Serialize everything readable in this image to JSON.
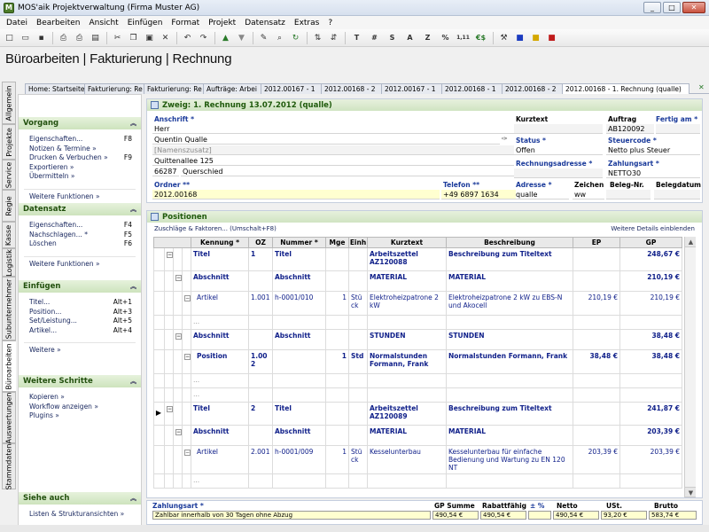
{
  "window": {
    "title": "MOS'aik Projektverwaltung (Firma Muster AG)",
    "min": "_",
    "max": "□",
    "close": "✕"
  },
  "menu": [
    "Datei",
    "Bearbeiten",
    "Ansicht",
    "Einfügen",
    "Format",
    "Projekt",
    "Datensatz",
    "Extras",
    "?"
  ],
  "toolbar": {
    "text_buttons": [
      "T",
      "#",
      "S",
      "A",
      "Z",
      "%",
      "1,11",
      "€$"
    ]
  },
  "page_title": "Büroarbeiten | Fakturierung | Rechnung",
  "vtabs": [
    "Allgemein",
    "Projekte",
    "Service",
    "Regie",
    "Kasse",
    "Logistik",
    "Subunternehmer",
    "Büroarbeiten",
    "Auswertungen",
    "Stammdaten"
  ],
  "sidebar": {
    "vorgang": {
      "title": "Vorgang",
      "items": [
        {
          "label": "Eigenschaften...",
          "key": "F8"
        },
        {
          "label": "Notizen & Termine »",
          "key": ""
        },
        {
          "label": "Drucken & Verbuchen »",
          "key": "F9"
        },
        {
          "label": "Exportieren »",
          "key": ""
        },
        {
          "label": "Übermitteln »",
          "key": ""
        }
      ],
      "more": "Weitere Funktionen »"
    },
    "datensatz": {
      "title": "Datensatz",
      "items": [
        {
          "label": "Eigenschaften...",
          "key": "F4"
        },
        {
          "label": "Nachschlagen... *",
          "key": "F5"
        },
        {
          "label": "Löschen",
          "key": "F6"
        }
      ],
      "more": "Weitere Funktionen »"
    },
    "einfuegen": {
      "title": "Einfügen",
      "items": [
        {
          "label": "Titel...",
          "key": "Alt+1"
        },
        {
          "label": "Position...",
          "key": "Alt+3"
        },
        {
          "label": "Set/Leistung...",
          "key": "Alt+5"
        },
        {
          "label": "Artikel...",
          "key": "Alt+4"
        }
      ],
      "more": "Weitere »"
    },
    "schritte": {
      "title": "Weitere Schritte",
      "items": [
        {
          "label": "Kopieren »",
          "key": ""
        },
        {
          "label": "Workflow anzeigen »",
          "key": ""
        },
        {
          "label": "Plugins »",
          "key": ""
        }
      ]
    },
    "siehe": {
      "title": "Siehe auch",
      "items": [
        {
          "label": "Listen & Strukturansichten »",
          "key": ""
        }
      ]
    }
  },
  "doctabs": [
    "Home: Startseite",
    "Fakturierung: Re",
    "Fakturierung: Re",
    "Aufträge: Arbei",
    "2012.00167 - 1",
    "2012.00168 - 2",
    "2012.00167 - 1",
    "2012.00168 - 1",
    "2012.00168 - 2",
    "2012.00168 - 1. Rechnung (qualle)"
  ],
  "form": {
    "header": "Zweig: 1. Rechnung 13.07.2012 (qualle)",
    "anschrift_label": "Anschrift *",
    "anrede": "Herr",
    "name": "Quentin Qualle",
    "zusatz": "[Namenszusatz]",
    "strasse": "Quittenallee 125",
    "plz": "66287",
    "ort": "Querschied",
    "ordner_label": "Ordner **",
    "ordner": "2012.00168",
    "telefon_label": "Telefon **",
    "telefon": "+49 6897 1634",
    "kurztext_label": "Kurztext",
    "status_label": "Status *",
    "status": "Offen",
    "rechnungsadresse_label": "Rechnungsadresse *",
    "adresse_label": "Adresse *",
    "adresse": "qualle",
    "zeichen_label": "Zeichen",
    "zeichen": "ww",
    "auftrag_label": "Auftrag",
    "auftrag": "AB120092",
    "fertig_label": "Fertig am *",
    "steuercode_label": "Steuercode *",
    "steuercode": "Netto plus Steuer",
    "zahlungsart_label": "Zahlungsart *",
    "zahlungsart": "NETTO30",
    "belegnr_label": "Beleg-Nr.",
    "belegdatum_label": "Belegdatum"
  },
  "positions": {
    "header": "Positionen",
    "link_left": "Zuschläge & Faktoren... (Umschalt+F8)",
    "link_right": "Weitere Details einblenden",
    "columns": [
      "Kennung *",
      "OZ",
      "Nummer *",
      "Mge",
      "Einh",
      "Kurztext",
      "Beschreibung",
      "EP",
      "GP"
    ],
    "rows": [
      {
        "cls": "title",
        "k": "Titel",
        "oz": "1",
        "nr": "Titel",
        "mge": "",
        "einh": "",
        "kurz": "Arbeitszettel AZ120088",
        "beschr": "Beschreibung zum Titeltext",
        "ep": "",
        "gp": "248,67 €"
      },
      {
        "cls": "abs",
        "k": "Abschnitt",
        "oz": "",
        "nr": "Abschnitt",
        "mge": "",
        "einh": "",
        "kurz": "MATERIAL",
        "beschr": "MATERIAL",
        "ep": "",
        "gp": "210,19 €"
      },
      {
        "cls": "art",
        "k": "Artikel",
        "oz": "1.001",
        "nr": "h-0001/010",
        "mge": "1",
        "einh": "Stück",
        "kurz": "Elektroheizpatrone 2 kW",
        "beschr": "Elektroheizpatrone 2 kW zu EBS-N und Akocell",
        "ep": "210,19 €",
        "gp": "210,19 €"
      },
      {
        "cls": "dots",
        "k": "...",
        "oz": "",
        "nr": "",
        "mge": "",
        "einh": "",
        "kurz": "",
        "beschr": "",
        "ep": "",
        "gp": ""
      },
      {
        "cls": "abs",
        "k": "Abschnitt",
        "oz": "",
        "nr": "Abschnitt",
        "mge": "",
        "einh": "",
        "kurz": "STUNDEN",
        "beschr": "STUNDEN",
        "ep": "",
        "gp": "38,48 €"
      },
      {
        "cls": "pos",
        "k": "Position",
        "oz": "1.002",
        "nr": "",
        "mge": "1",
        "einh": "Std",
        "kurz": "Normalstunden Formann, Frank",
        "beschr": "Normalstunden Formann, Frank",
        "ep": "38,48 €",
        "gp": "38,48 €"
      },
      {
        "cls": "dots",
        "k": "...",
        "oz": "",
        "nr": "",
        "mge": "",
        "einh": "",
        "kurz": "",
        "beschr": "",
        "ep": "",
        "gp": ""
      },
      {
        "cls": "dots",
        "k": "...",
        "oz": "",
        "nr": "",
        "mge": "",
        "einh": "",
        "kurz": "",
        "beschr": "",
        "ep": "",
        "gp": ""
      },
      {
        "cls": "title",
        "k": "Titel",
        "oz": "2",
        "nr": "Titel",
        "mge": "",
        "einh": "",
        "kurz": "Arbeitszettel AZ120089",
        "beschr": "Beschreibung zum Titeltext",
        "ep": "",
        "gp": "241,87 €"
      },
      {
        "cls": "abs",
        "k": "Abschnitt",
        "oz": "",
        "nr": "Abschnitt",
        "mge": "",
        "einh": "",
        "kurz": "MATERIAL",
        "beschr": "MATERIAL",
        "ep": "",
        "gp": "203,39 €"
      },
      {
        "cls": "art",
        "k": "Artikel",
        "oz": "2.001",
        "nr": "h-0001/009",
        "mge": "1",
        "einh": "Stück",
        "kurz": "Kesselunterbau",
        "beschr": "Kesselunterbau für einfache Bedienung und Wartung zu EN 120 NT",
        "ep": "203,39 €",
        "gp": "203,39 €"
      },
      {
        "cls": "dots",
        "k": "...",
        "oz": "",
        "nr": "",
        "mge": "",
        "einh": "",
        "kurz": "",
        "beschr": "",
        "ep": "",
        "gp": ""
      }
    ]
  },
  "summary": {
    "zahlungsart_label": "Zahlungsart *",
    "zahlungsart": "Zahlbar innerhalb von 30 Tagen ohne Abzug",
    "gp_label": "GP Summe",
    "gp": "490,54 €",
    "rabatt_label": "Rabattfähig",
    "rabatt": "490,54 €",
    "pct_label": "± %",
    "netto_label": "Netto",
    "netto": "490,54 €",
    "ust_label": "USt.",
    "ust": "93,20 €",
    "brutto_label": "Brutto",
    "brutto": "583,74 €"
  }
}
